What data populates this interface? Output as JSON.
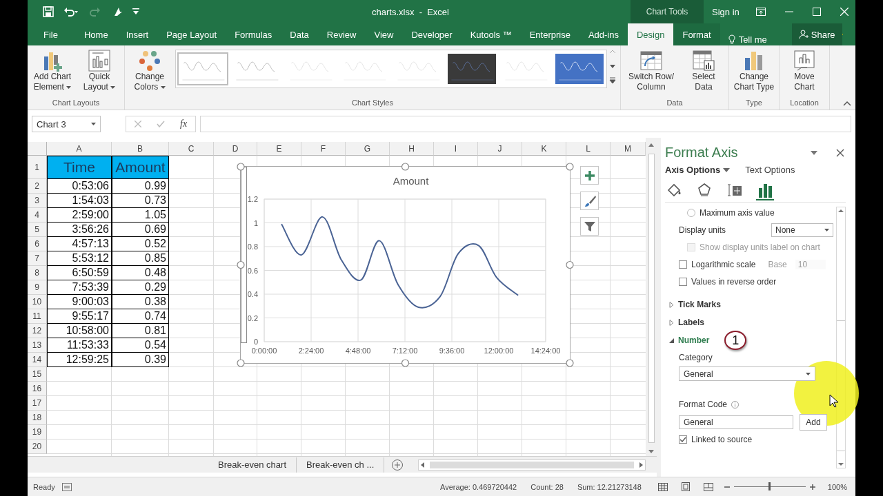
{
  "title_bar": {
    "document_title": "charts.xlsx  -  Excel",
    "context_label": "Chart Tools",
    "sign_in": "Sign in"
  },
  "ribbon_tabs": [
    {
      "label": "File",
      "selected": false
    },
    {
      "label": "Home",
      "selected": false
    },
    {
      "label": "Insert",
      "selected": false
    },
    {
      "label": "Page Layout",
      "selected": false
    },
    {
      "label": "Formulas",
      "selected": false
    },
    {
      "label": "Data",
      "selected": false
    },
    {
      "label": "Review",
      "selected": false
    },
    {
      "label": "View",
      "selected": false
    },
    {
      "label": "Developer",
      "selected": false
    },
    {
      "label": "Kutools ™",
      "selected": false
    },
    {
      "label": "Enterprise",
      "selected": false
    },
    {
      "label": "Add-ins",
      "selected": false
    },
    {
      "label": "Design",
      "selected": true
    },
    {
      "label": "Format",
      "selected": false
    }
  ],
  "tell_me": "Tell me",
  "share": "Share",
  "ribbon_groups": [
    {
      "label": "Chart Layouts",
      "buttons": [
        {
          "label": "Add Chart Element",
          "kind": "add-chart",
          "dropdown": true
        },
        {
          "label": "Quick Layout",
          "kind": "quick-layout",
          "dropdown": true
        }
      ]
    },
    {
      "label": "Chart Styles",
      "buttons": [
        {
          "label": "Change Colors",
          "kind": "colors",
          "dropdown": true
        }
      ],
      "styles": [
        {
          "kind": "light",
          "selected": true
        },
        {
          "kind": "light",
          "selected": false
        },
        {
          "kind": "faint",
          "selected": false
        },
        {
          "kind": "faint",
          "selected": false
        },
        {
          "kind": "faint",
          "selected": false
        },
        {
          "kind": "dark",
          "selected": false
        },
        {
          "kind": "faint",
          "selected": false
        },
        {
          "kind": "blue",
          "selected": false
        }
      ]
    },
    {
      "label": "Data",
      "buttons": [
        {
          "label": "Switch Row/ Column",
          "kind": "switch",
          "dropdown": false
        },
        {
          "label": "Select Data",
          "kind": "select-data",
          "dropdown": false
        }
      ]
    },
    {
      "label": "Type",
      "buttons": [
        {
          "label": "Change Chart Type",
          "kind": "chart-type",
          "dropdown": false
        }
      ]
    },
    {
      "label": "Location",
      "buttons": [
        {
          "label": "Move Chart",
          "kind": "move-chart",
          "dropdown": false
        }
      ]
    }
  ],
  "name_box": "Chart 3",
  "fx_label": "fx",
  "columns": [
    "A",
    "B",
    "C",
    "D",
    "E",
    "F",
    "G",
    "H",
    "I",
    "J",
    "K",
    "L",
    "M"
  ],
  "row_numbers": [
    "1",
    "2",
    "3",
    "4",
    "5",
    "6",
    "7",
    "8",
    "9",
    "10",
    "11",
    "12",
    "13",
    "14",
    "15",
    "16",
    "17",
    "18",
    "19",
    "20"
  ],
  "table": {
    "header": [
      "Time",
      "Amount"
    ],
    "rows": [
      [
        "0:53:06",
        "0.99"
      ],
      [
        "1:54:03",
        "0.73"
      ],
      [
        "2:59:00",
        "1.05"
      ],
      [
        "3:56:26",
        "0.69"
      ],
      [
        "4:57:13",
        "0.52"
      ],
      [
        "5:53:12",
        "0.85"
      ],
      [
        "6:50:59",
        "0.48"
      ],
      [
        "7:53:39",
        "0.29"
      ],
      [
        "9:00:03",
        "0.38"
      ],
      [
        "9:55:17",
        "0.74"
      ],
      [
        "10:58:00",
        "0.81"
      ],
      [
        "11:53:33",
        "0.54"
      ],
      [
        "12:59:25",
        "0.39"
      ]
    ]
  },
  "chart": {
    "chart_data": {
      "type": "line",
      "title": "Amount",
      "x": [
        0.885,
        1.9008,
        2.9833,
        3.9406,
        4.9536,
        5.8867,
        6.8497,
        7.8942,
        9.0008,
        9.9214,
        10.9667,
        11.8925,
        12.9903
      ],
      "grid": true,
      "series": [
        {
          "color": "#4a6394",
          "values": [
            0.99,
            0.73,
            1.05,
            0.69,
            0.52,
            0.85,
            0.48,
            0.29,
            0.38,
            0.74,
            0.81,
            0.54,
            0.39
          ]
        }
      ],
      "xlim": [
        0,
        14.4
      ],
      "ylim": [
        0,
        1.2
      ],
      "xticks": [
        {
          "value": 0,
          "label": "0:00:00"
        },
        {
          "value": 2.4,
          "label": "2:24:00"
        },
        {
          "value": 4.8,
          "label": "4:48:00"
        },
        {
          "value": 7.2,
          "label": "7:12:00"
        },
        {
          "value": 9.6,
          "label": "9:36:00"
        },
        {
          "value": 12,
          "label": "12:00:00"
        },
        {
          "value": 14.4,
          "label": "14:24:00"
        }
      ],
      "yticks": [
        {
          "value": 0,
          "label": "0"
        },
        {
          "value": 0.2,
          "label": "0.2"
        },
        {
          "value": 0.4,
          "label": "0.4"
        },
        {
          "value": 0.6,
          "label": "0.6"
        },
        {
          "value": 0.8,
          "label": "0.8"
        },
        {
          "value": 1,
          "label": "1"
        },
        {
          "value": 1.2,
          "label": "1.2"
        }
      ]
    }
  },
  "format_pane": {
    "title": "Format Axis",
    "tabs": [
      {
        "label": "Axis Options",
        "selected": true
      },
      {
        "label": "Text Options",
        "selected": false
      }
    ],
    "icon_tabs": [
      {
        "kind": "fill",
        "selected": false
      },
      {
        "kind": "effects",
        "selected": false
      },
      {
        "kind": "size",
        "selected": false
      },
      {
        "kind": "axis",
        "selected": true
      }
    ],
    "options": [
      {
        "kind": "radio",
        "label": "Maximum axis value",
        "selected": false
      },
      {
        "kind": "dropdown",
        "label": "Display units",
        "value": "None"
      },
      {
        "kind": "checkbox",
        "label": "Show display units label on chart",
        "checked": false,
        "disabled": true
      },
      {
        "kind": "checkbox",
        "label": "Logarithmic scale",
        "checked": false,
        "disabled": false,
        "base_label": "Base",
        "base_value": "10"
      },
      {
        "kind": "checkbox",
        "label": "Values in reverse order",
        "checked": false,
        "disabled": false
      }
    ],
    "sections": [
      {
        "label": "Tick Marks",
        "expanded": false
      },
      {
        "label": "Labels",
        "expanded": false
      },
      {
        "label": "Number",
        "expanded": true,
        "badge": "1"
      }
    ],
    "number": {
      "category_label": "Category",
      "category_value": "General",
      "format_code_label": "Format Code",
      "format_code_value": "General",
      "add_button": "Add",
      "linked_to_source": {
        "label": "Linked to source",
        "checked": true
      }
    }
  },
  "sheet_tabs": [
    {
      "label": "Break-even chart",
      "selected": false
    },
    {
      "label": "Break-even ch ...",
      "selected": false
    }
  ],
  "status_bar": {
    "mode": "Ready",
    "average": "Average: 0.469720442",
    "count": "Count: 28",
    "sum": "Sum: 12.21273148",
    "zoom": "100%",
    "zoom_slider": {
      "level": 0.5
    }
  }
}
